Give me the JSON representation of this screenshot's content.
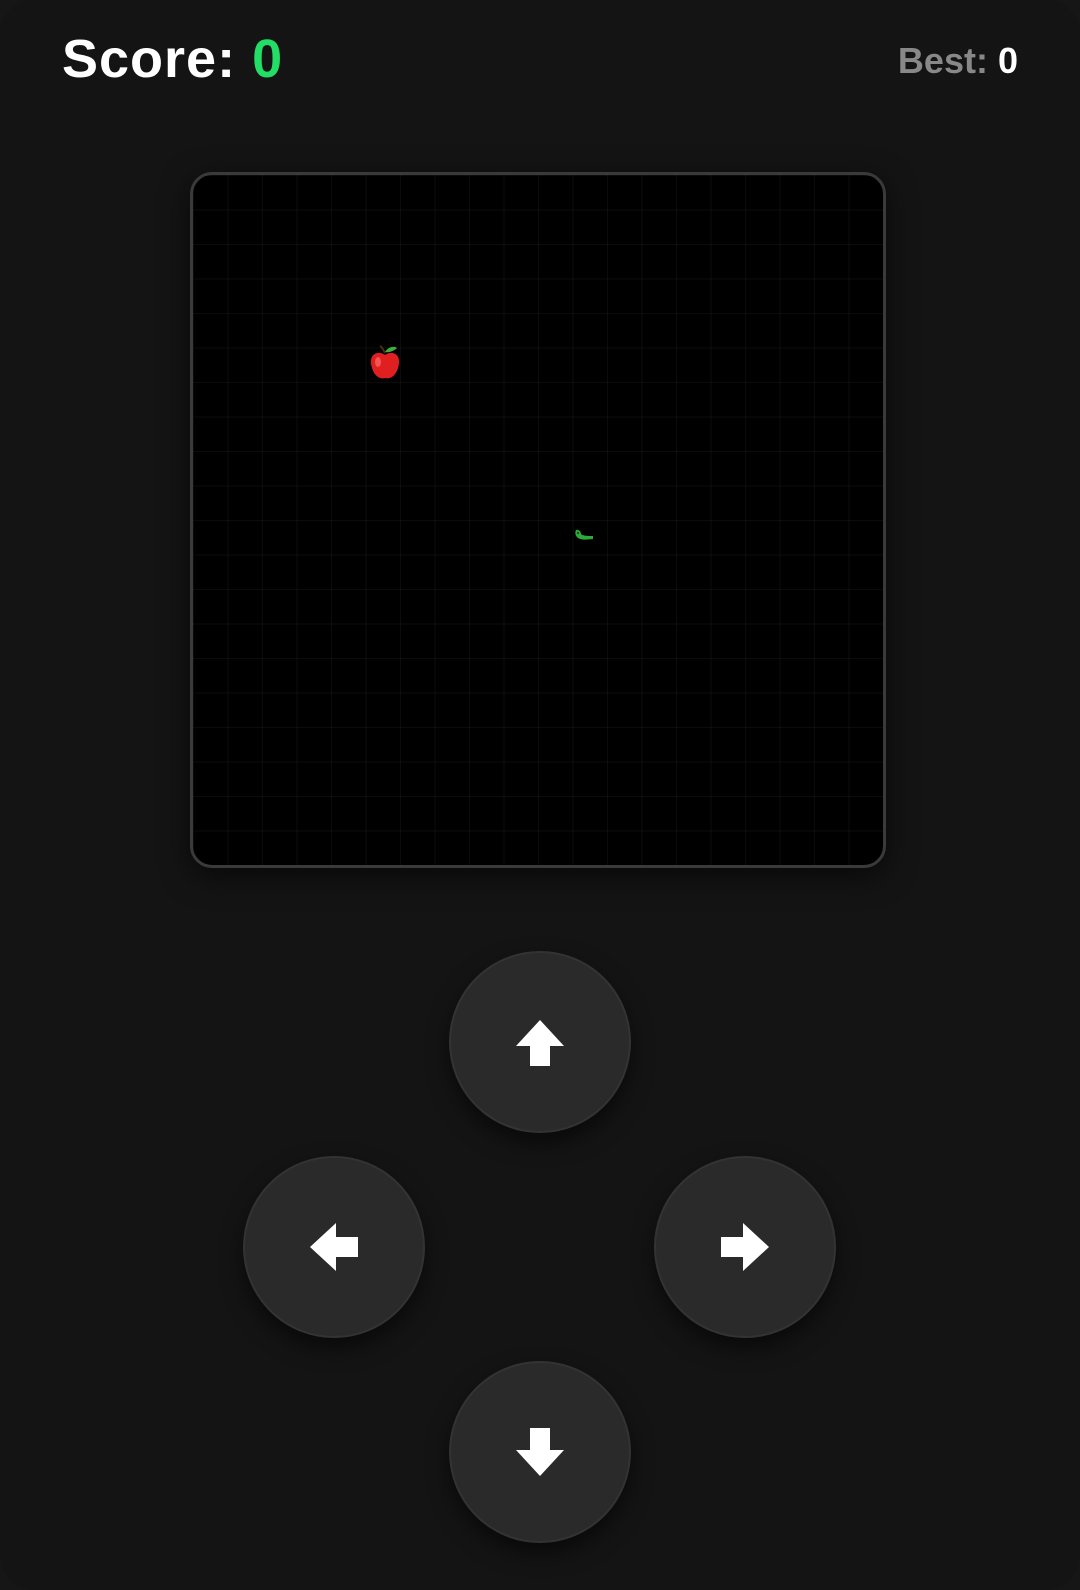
{
  "header": {
    "score_label": "Score:",
    "score_value": "0",
    "best_label": "Best:",
    "best_value": "0"
  },
  "board": {
    "apple_icon": "apple-icon",
    "snake_icon": "snake-segment"
  },
  "controls": {
    "up_icon": "arrow-up-icon",
    "left_icon": "arrow-left-icon",
    "right_icon": "arrow-right-icon",
    "down_icon": "arrow-down-icon"
  },
  "colors": {
    "background": "#141414",
    "board": "#000000",
    "score_accent": "#22dd66",
    "button": "#2a2a2a",
    "apple": "#e02020",
    "snake": "#2eaa3a"
  }
}
